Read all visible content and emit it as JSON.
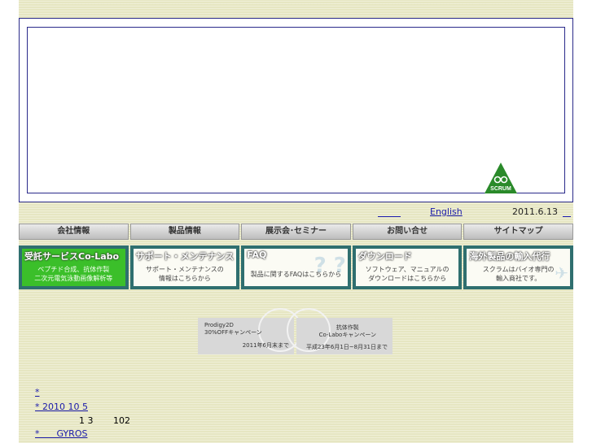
{
  "utility": {
    "english_label": "English",
    "date": "2011.6.13"
  },
  "logo": {
    "text": "SCRUM",
    "color": "#2a8a2a"
  },
  "nav": [
    {
      "label": "会社情報"
    },
    {
      "label": "製品情報"
    },
    {
      "label": "展示会･セミナー"
    },
    {
      "label": "お問い合せ"
    },
    {
      "label": "サイトマップ"
    }
  ],
  "banners": [
    {
      "title": "受託サービスCo-Labo",
      "desc1": "ペプチド合成、抗体作製",
      "desc2": "二次元電気泳動画像解析等",
      "highlight": true
    },
    {
      "title": "サポート・メンテナンス",
      "desc1": "サポート・メンテナンスの",
      "desc2": "情報はこちらから",
      "highlight": false
    },
    {
      "title": "FAQ",
      "desc1": "製品に関するFAQはこちらから",
      "desc2": "",
      "highlight": false
    },
    {
      "title": "ダウンロード",
      "desc1": "ソフトウェア、マニュアルの",
      "desc2": "ダウンロードはこちらから",
      "highlight": false
    },
    {
      "title": "海外製品の輸入代行",
      "desc1": "スクラムはバイオ専門の",
      "desc2": "輸入商社です。",
      "highlight": false
    }
  ],
  "promos": [
    {
      "line1": "Prodigy2D",
      "line2": "30%OFFキャンペーン",
      "line3": "2011年6月末まで"
    },
    {
      "line1": "抗体作製",
      "line2": "Co-Laboキャンペーン",
      "line3": "平成23年6月1日~8月31日まで"
    }
  ],
  "news": [
    {
      "text": "*"
    },
    {
      "text": "* 2010 10 5"
    },
    {
      "text": "1 3       102"
    },
    {
      "text": "*      GYROS"
    }
  ],
  "colors": {
    "link": "#1a1aaa",
    "border": "#2a2a8a",
    "highlight": "#3bbf2a",
    "banner_frame": "#2f6f6f"
  }
}
